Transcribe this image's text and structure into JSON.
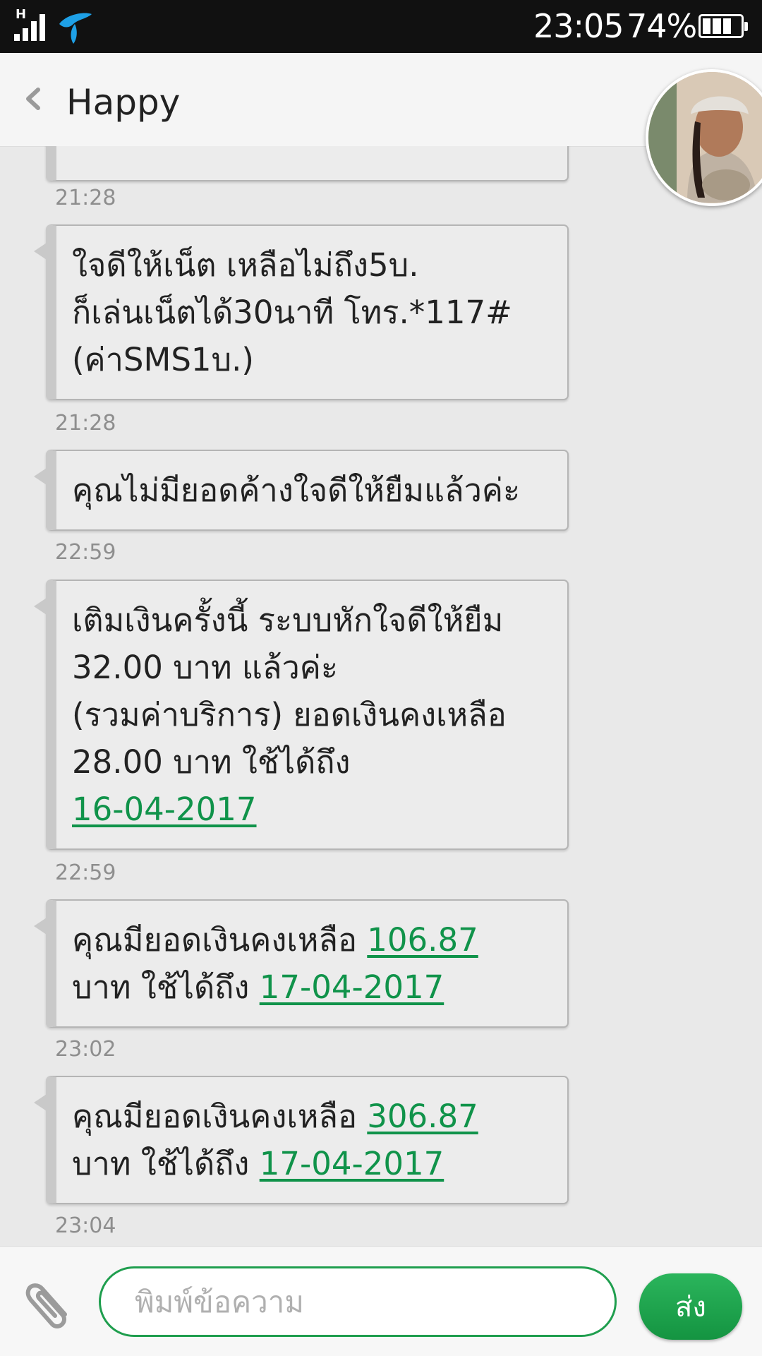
{
  "status_bar": {
    "network_type": "H",
    "time": "23:05",
    "battery_percent": "74%",
    "battery_level": 0.74,
    "icons": [
      "signal-icon",
      "carrier-icon",
      "battery-icon"
    ]
  },
  "header": {
    "back_icon": "chevron-left-icon",
    "contact_name": "Happy",
    "avatar": "contact-avatar"
  },
  "messages": [
    {
      "lines": [
        "ใจดีให้เน็ต เหลือไม่ถึง5บ.",
        "ก็เล่นเน็ตได้30นาที โทร.*117#",
        "(ค่าSMS1บ.)"
      ],
      "time": "21:28"
    },
    {
      "lines": [
        "คุณไม่มียอดค้างใจดีให้ยืมแล้วค่ะ"
      ],
      "time": "22:59"
    },
    {
      "lines": [
        "เติมเงินครั้งนี้ ระบบหักใจดีให้ยืม",
        "32.00 บาท แล้วค่ะ",
        "(รวมค่าบริการ) ยอดเงินคงเหลือ",
        "28.00 บาท ใช้ได้ถึง"
      ],
      "link": "16-04-2017",
      "time": "22:59"
    },
    {
      "line1_text": "คุณมียอดเงินคงเหลือ",
      "line1_link": "106.87",
      "line2_text": "บาท ใช้ได้ถึง",
      "line2_link": "17-04-2017",
      "time": "23:02"
    },
    {
      "line1_text": "คุณมียอดเงินคงเหลือ",
      "line1_link": "306.87",
      "line2_text": "บาท ใช้ได้ถึง",
      "line2_link": "17-04-2017",
      "time": "23:04"
    }
  ],
  "previous_message_time": "21:28",
  "compose": {
    "attach_icon": "paperclip-icon",
    "placeholder": "พิมพ์ข้อความ",
    "send_label": "ส่ง"
  },
  "colors": {
    "accent_green": "#10934a",
    "status_bar_bg": "#111111",
    "background": "#e9e9e9"
  }
}
